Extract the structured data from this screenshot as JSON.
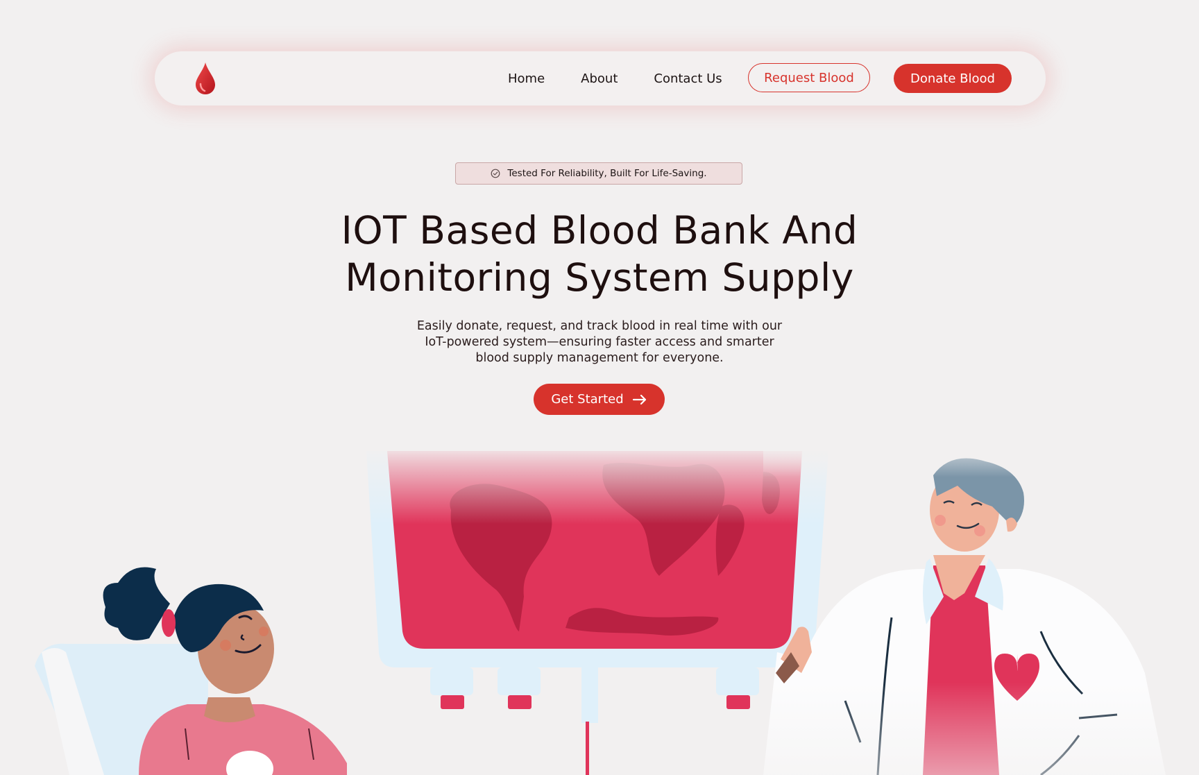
{
  "nav": {
    "logo_icon": "blood-drop-icon",
    "links": [
      "Home",
      "About",
      "Contact Us"
    ],
    "request_label": "Request Blood",
    "donate_label": "Donate Blood"
  },
  "badge": {
    "icon": "verified-check-icon",
    "text": "Tested For Reliability, Built For Life-Saving."
  },
  "hero": {
    "title_line1": "IOT Based Blood Bank And",
    "title_line2": "Monitoring System Supply",
    "subtitle_line1": "Easily donate, request, and track blood in real time with our",
    "subtitle_line2": "IoT-powered system—ensuring faster access and smarter",
    "subtitle_line3": "blood supply management for everyone.",
    "cta_label": "Get Started",
    "cta_icon": "arrow-right-icon"
  },
  "colors": {
    "brand": "#d7332c",
    "background": "#f2f0f0",
    "blood": "#e0345a",
    "text": "#1e0f0f"
  }
}
